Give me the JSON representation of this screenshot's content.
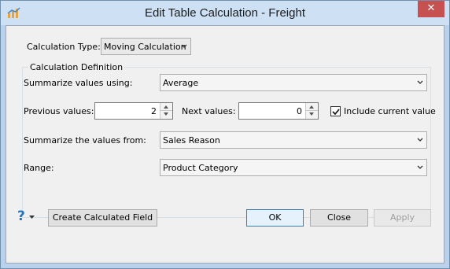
{
  "window": {
    "title": "Edit Table Calculation - Freight"
  },
  "calc_type": {
    "label": "Calculation Type:",
    "value": "Moving Calculation"
  },
  "group": {
    "title": "Calculation Definition"
  },
  "summarize_using": {
    "label": "Summarize values using:",
    "value": "Average"
  },
  "previous": {
    "label": "Previous values:",
    "value": "2"
  },
  "next": {
    "label": "Next values:",
    "value": "0"
  },
  "include_current": {
    "label": "Include current value",
    "checked": true
  },
  "summarize_from": {
    "label": "Summarize the values from:",
    "value": "Sales Reason"
  },
  "range": {
    "label": "Range:",
    "value": "Product Category"
  },
  "buttons": {
    "create_field": "Create Calculated Field",
    "ok": "OK",
    "close": "Close",
    "apply": "Apply"
  },
  "colors": {
    "title_bar": "#cde0f4",
    "close_button": "#c75050",
    "dialog_bg": "#f0f0f0",
    "help_blue": "#1f74c7"
  }
}
